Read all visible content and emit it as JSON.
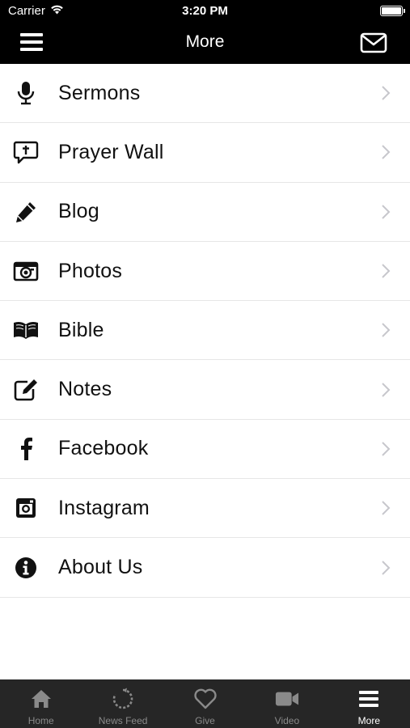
{
  "status_bar": {
    "carrier": "Carrier",
    "time": "3:20 PM",
    "battery_level": 1.0
  },
  "nav": {
    "title": "More",
    "menu_icon": "hamburger-menu-icon",
    "mail_icon": "envelope-icon"
  },
  "menu": {
    "items": [
      {
        "label": "Sermons",
        "icon": "microphone-icon"
      },
      {
        "label": "Prayer Wall",
        "icon": "speech-bubble-icon"
      },
      {
        "label": "Blog",
        "icon": "pencil-icon"
      },
      {
        "label": "Photos",
        "icon": "camera-icon"
      },
      {
        "label": "Bible",
        "icon": "open-book-icon"
      },
      {
        "label": "Notes",
        "icon": "edit-note-icon"
      },
      {
        "label": "Facebook",
        "icon": "facebook-icon"
      },
      {
        "label": "Instagram",
        "icon": "instagram-icon"
      },
      {
        "label": "About Us",
        "icon": "info-icon"
      }
    ],
    "chevron_color": "#c7c7cc"
  },
  "tabs": {
    "items": [
      {
        "label": "Home",
        "icon": "home-icon",
        "active": false
      },
      {
        "label": "News Feed",
        "icon": "refresh-icon",
        "active": false
      },
      {
        "label": "Give",
        "icon": "heart-icon",
        "active": false
      },
      {
        "label": "Video",
        "icon": "video-camera-icon",
        "active": false
      },
      {
        "label": "More",
        "icon": "hamburger-menu-icon",
        "active": true
      }
    ],
    "active_color": "#ffffff",
    "inactive_color": "#8a8a8a"
  }
}
